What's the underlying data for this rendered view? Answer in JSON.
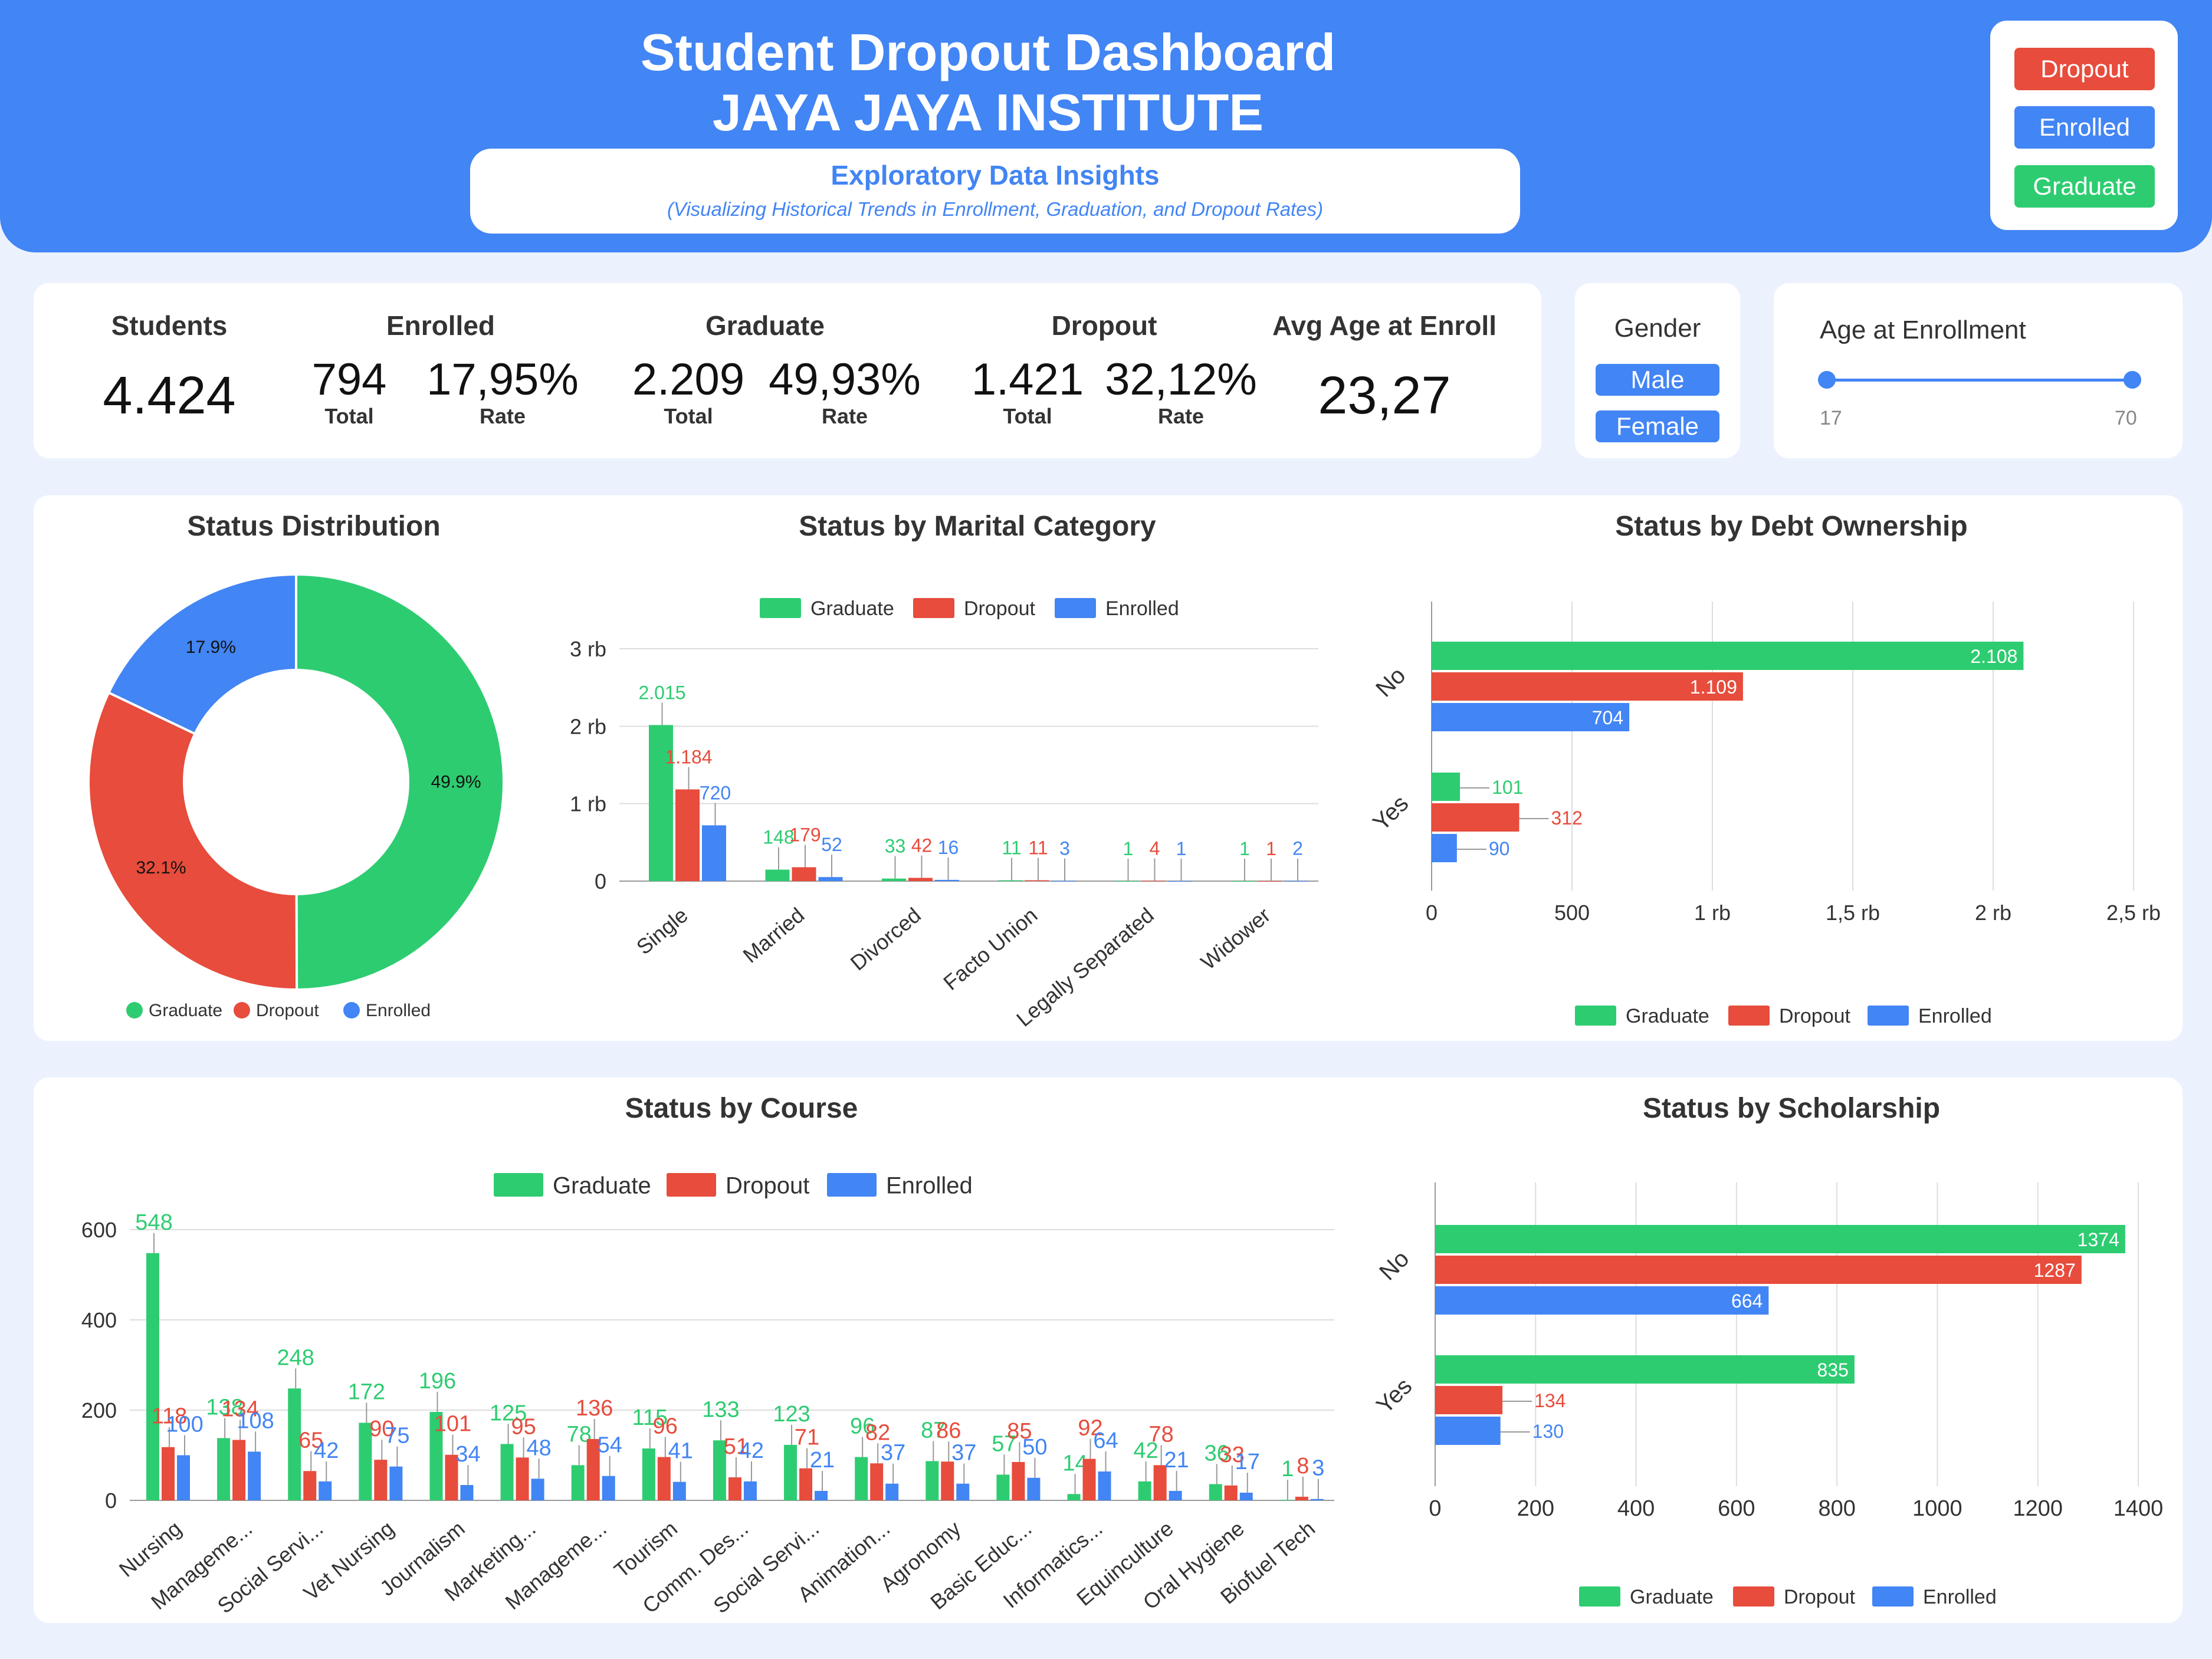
{
  "colors": {
    "graduate": "#2ecc71",
    "dropout": "#e74c3c",
    "enrolled": "#4285f4",
    "header": "#4285f4"
  },
  "header": {
    "title": "Student Dropout Dashboard",
    "subtitle": "JAYA JAYA INSTITUTE",
    "insight_title": "Exploratory Data Insights",
    "insight_subtitle": "(Visualizing Historical Trends in Enrollment, Graduation, and Dropout Rates)"
  },
  "status_legend": {
    "dropout": "Dropout",
    "enrolled": "Enrolled",
    "graduate": "Graduate"
  },
  "kpis": {
    "students_label": "Students",
    "students_value": "4.424",
    "enrolled_label": "Enrolled",
    "enrolled_total": "794",
    "enrolled_rate": "17,95%",
    "graduate_label": "Graduate",
    "graduate_total": "2.209",
    "graduate_rate": "49,93%",
    "dropout_label": "Dropout",
    "dropout_total": "1.421",
    "dropout_rate": "32,12%",
    "total_label": "Total",
    "rate_label": "Rate",
    "avg_age_label": "Avg Age at Enroll",
    "avg_age_value": "23,27"
  },
  "filters": {
    "gender_label": "Gender",
    "gender_options": [
      "Male",
      "Female"
    ],
    "age_label": "Age at Enrollment",
    "age_min": "17",
    "age_max": "70"
  },
  "chart_data": [
    {
      "id": "status_distribution",
      "type": "pie",
      "title": "Status Distribution",
      "labels": [
        "Graduate",
        "Dropout",
        "Enrolled"
      ],
      "values": [
        49.9,
        32.1,
        17.9
      ],
      "value_labels": [
        "49.9%",
        "32.1%",
        "17.9%"
      ],
      "legend": "bottom"
    },
    {
      "id": "status_by_marital",
      "type": "bar",
      "title": "Status by Marital Category",
      "categories": [
        "Single",
        "Married",
        "Divorced",
        "Facto Union",
        "Legally Separated",
        "Widower"
      ],
      "series": [
        {
          "name": "Graduate",
          "values": [
            2015,
            148,
            33,
            11,
            1,
            1
          ],
          "labels": [
            "2.015",
            "148",
            "33",
            "11",
            "1",
            "1"
          ]
        },
        {
          "name": "Dropout",
          "values": [
            1184,
            179,
            42,
            11,
            4,
            1
          ],
          "labels": [
            "1.184",
            "179",
            "42",
            "11",
            "4",
            "1"
          ]
        },
        {
          "name": "Enrolled",
          "values": [
            720,
            52,
            16,
            3,
            1,
            2
          ],
          "labels": [
            "720",
            "52",
            "16",
            "3",
            "1",
            "2"
          ]
        }
      ],
      "ylim": [
        0,
        3000
      ],
      "yticks": [
        "0",
        "1 rb",
        "2 rb",
        "3 rb"
      ],
      "legend": "top",
      "grid": true
    },
    {
      "id": "status_by_debt",
      "type": "bar",
      "orientation": "horizontal",
      "title": "Status by Debt Ownership",
      "categories": [
        "No",
        "Yes"
      ],
      "series": [
        {
          "name": "Graduate",
          "values": [
            2108,
            101
          ],
          "labels": [
            "2.108",
            "101"
          ]
        },
        {
          "name": "Dropout",
          "values": [
            1109,
            312
          ],
          "labels": [
            "1.109",
            "312"
          ]
        },
        {
          "name": "Enrolled",
          "values": [
            704,
            90
          ],
          "labels": [
            "704",
            "90"
          ]
        }
      ],
      "xlim": [
        0,
        2500
      ],
      "xticks": [
        "0",
        "500",
        "1 rb",
        "1,5 rb",
        "2 rb",
        "2,5 rb"
      ],
      "legend": "bottom",
      "grid": true
    },
    {
      "id": "status_by_course",
      "type": "bar",
      "title": "Status by Course",
      "categories": [
        "Nursing",
        "Manageme...",
        "Social Servi...",
        "Vet Nursing",
        "Journalism",
        "Marketing...",
        "Manageme...",
        "Tourism",
        "Comm. Des...",
        "Social Servi...",
        "Animation...",
        "Agronomy",
        "Basic Educ...",
        "Informatics...",
        "Equinculture",
        "Oral Hygiene",
        "Biofuel Tech"
      ],
      "series": [
        {
          "name": "Graduate",
          "values": [
            548,
            138,
            248,
            172,
            196,
            125,
            78,
            115,
            133,
            123,
            96,
            87,
            57,
            14,
            42,
            36,
            1
          ]
        },
        {
          "name": "Dropout",
          "values": [
            118,
            134,
            65,
            90,
            101,
            95,
            136,
            96,
            51,
            71,
            82,
            86,
            85,
            92,
            78,
            33,
            8
          ]
        },
        {
          "name": "Enrolled",
          "values": [
            100,
            108,
            42,
            75,
            34,
            48,
            54,
            41,
            42,
            21,
            37,
            37,
            50,
            64,
            21,
            17,
            3
          ]
        }
      ],
      "ylim": [
        0,
        600
      ],
      "yticks": [
        "0",
        "200",
        "400",
        "600"
      ],
      "legend": "top",
      "grid": true
    },
    {
      "id": "status_by_scholarship",
      "type": "bar",
      "orientation": "horizontal",
      "title": "Status by Scholarship",
      "categories": [
        "No",
        "Yes"
      ],
      "series": [
        {
          "name": "Graduate",
          "values": [
            1374,
            835
          ]
        },
        {
          "name": "Dropout",
          "values": [
            1287,
            134
          ]
        },
        {
          "name": "Enrolled",
          "values": [
            664,
            130
          ]
        }
      ],
      "xlim": [
        0,
        1400
      ],
      "xticks": [
        "0",
        "200",
        "400",
        "600",
        "800",
        "1000",
        "1200",
        "1400"
      ],
      "legend": "bottom",
      "grid": true
    }
  ]
}
